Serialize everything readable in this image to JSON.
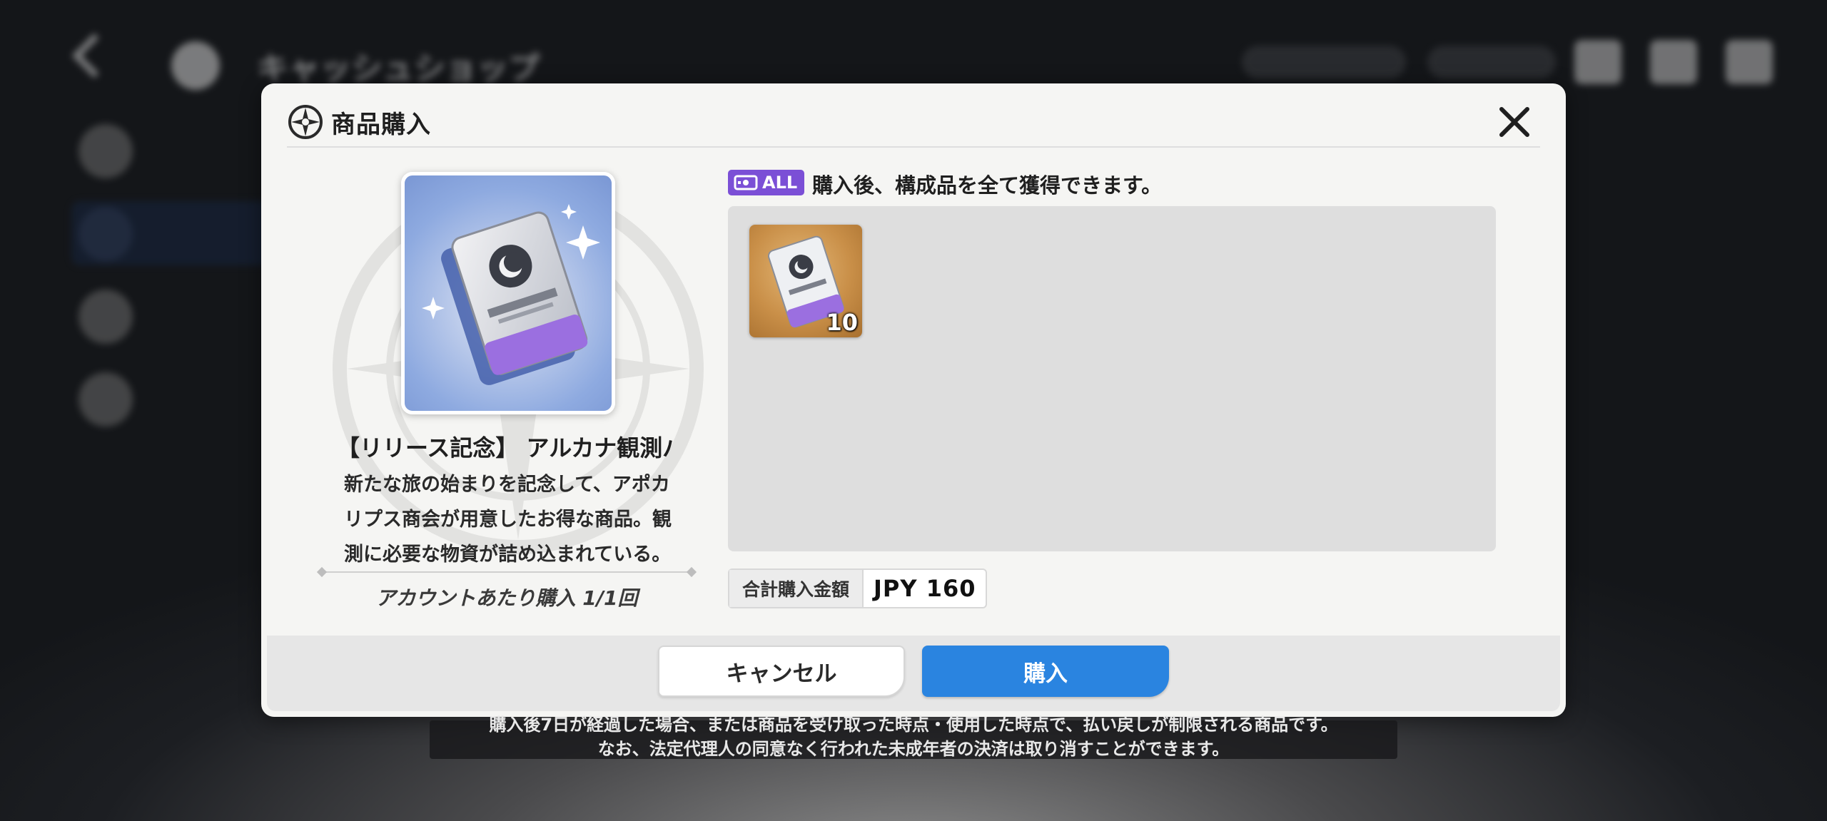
{
  "background": {
    "title": "キャッシュショップ"
  },
  "modal": {
    "title": "商品購入",
    "close_icon": "close-icon"
  },
  "product": {
    "name": "【リリース記念】 アルカナ観測パ",
    "description": "新たな旅の始まりを記念して、アポカリプス商会が用意したお得な商品。観測に必要な物資が詰め込まれている。",
    "purchase_limit": "アカウントあたり購入 1/1回"
  },
  "rewards": {
    "badge_label": "ALL",
    "note": "購入後、構成品を全て獲得できます。",
    "items": [
      {
        "icon": "observe-ticket-icon",
        "quantity": "10"
      }
    ]
  },
  "total": {
    "label": "合計購入金額",
    "price": "JPY 160"
  },
  "buttons": {
    "cancel": "キャンセル",
    "buy": "購入"
  },
  "notice": {
    "line1": "購入後7日が経過した場合、または商品を受け取った時点・使用した時点で、払い戻しが制限される商品です。",
    "line2": "なお、法定代理人の同意なく行われた未成年者の決済は取り消すことができます。"
  },
  "colors": {
    "buy_button": "#2a84e0",
    "badge": "#7b4fd6",
    "modal_bg": "#f5f5f3"
  }
}
